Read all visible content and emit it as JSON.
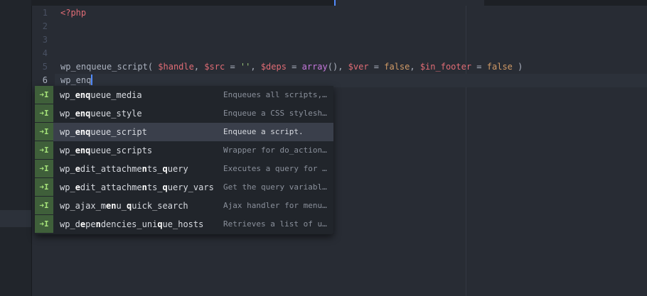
{
  "editor": {
    "line_numbers": [
      "1",
      "2",
      "3",
      "4",
      "5",
      "6"
    ],
    "lines": {
      "l1": {
        "tag": "<?php"
      },
      "l5": {
        "fn": "wp_enqueue_script",
        "p1": "( ",
        "v_handle": "$handle",
        "p2": ", ",
        "v_src": "$src",
        "p3": " = ",
        "s_empty": "''",
        "p4": ", ",
        "v_deps": "$deps",
        "p5": " = ",
        "k_array": "array",
        "p6": "(), ",
        "v_ver": "$ver",
        "p7": " = ",
        "c_false1": "false",
        "p8": ", ",
        "v_footer": "$in_footer",
        "p9": " = ",
        "c_false2": "false",
        "p10": " )"
      },
      "l6": {
        "typed": "wp_enq"
      }
    }
  },
  "autocomplete": {
    "items": [
      {
        "icon": "➜I",
        "p1": "wp_",
        "m1": "enq",
        "p2": "ueue_media",
        "desc": "Enqueues all scripts,…"
      },
      {
        "icon": "➜I",
        "p1": "wp_",
        "m1": "enq",
        "p2": "ueue_style",
        "desc": "Enqueue a CSS stylesh…"
      },
      {
        "icon": "➜I",
        "p1": "wp_",
        "m1": "enq",
        "p2": "ueue_script",
        "desc": "Enqueue a script."
      },
      {
        "icon": "➜I",
        "p1": "wp_",
        "m1": "enq",
        "p2": "ueue_scripts",
        "desc": "Wrapper for do_action…"
      },
      {
        "icon": "➜I",
        "p1": "wp_",
        "m1": "e",
        "p2": "dit_attachme",
        "m2": "n",
        "p3": "ts_",
        "m3": "q",
        "p4": "uery",
        "desc": "Executes a query for …"
      },
      {
        "icon": "➜I",
        "p1": "wp_",
        "m1": "e",
        "p2": "dit_attachme",
        "m2": "n",
        "p3": "ts_",
        "m3": "q",
        "p4": "uery_vars",
        "desc": "Get the query variabl…"
      },
      {
        "icon": "➜I",
        "p1": "wp_ajax_m",
        "m1": "e",
        "p2": "",
        "m2": "n",
        "p3": "u_",
        "m3": "q",
        "p4": "uick_search",
        "desc": "Ajax handler for menu…"
      },
      {
        "icon": "➜I",
        "p1": "wp_d",
        "m1": "e",
        "p2": "pe",
        "m2": "n",
        "p3": "dencies_uni",
        "m3": "q",
        "p4": "ue_hosts",
        "desc": "Retrieves a list of u…"
      }
    ]
  },
  "colors": {
    "background": "#282c34",
    "selected_row": "#3a3f4b",
    "snippet_icon": "#3f5f3a",
    "cursor": "#528bff"
  }
}
